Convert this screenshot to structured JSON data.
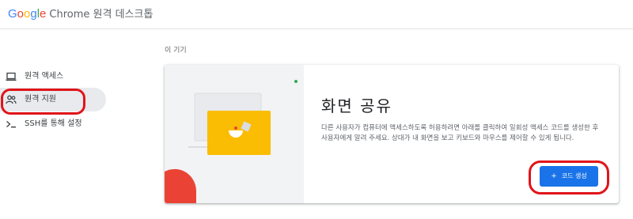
{
  "header": {
    "brand_letters": [
      "G",
      "o",
      "o",
      "g",
      "l",
      "e"
    ],
    "product": "Chrome 원격 데스크톱"
  },
  "sidebar": {
    "items": [
      {
        "label": "원격 액세스",
        "icon": "laptop-icon",
        "selected": false
      },
      {
        "label": "원격 지원",
        "icon": "people-icon",
        "selected": true
      },
      {
        "label": "SSH를 통해 설정",
        "icon": "terminal-icon",
        "selected": false
      }
    ]
  },
  "main": {
    "section_label": "이 기기",
    "card": {
      "title": "화면 공유",
      "description": "다른 사용자가 컴퓨터에 액세스하도록 허용하려면 아래를 클릭하여 일회성 액세스 코드를 생성한 후 사용자에게 알려 주세요. 상대가 내 화면을 보고 키보드와 마우스를 제어할 수 있게 됩니다.",
      "button": {
        "icon": "+",
        "label": "코드 생성"
      }
    }
  },
  "colors": {
    "accent": "#1a73e8",
    "highlight": "#e0141a",
    "illustration_yellow": "#fbbc04",
    "illustration_red": "#ea4335"
  }
}
